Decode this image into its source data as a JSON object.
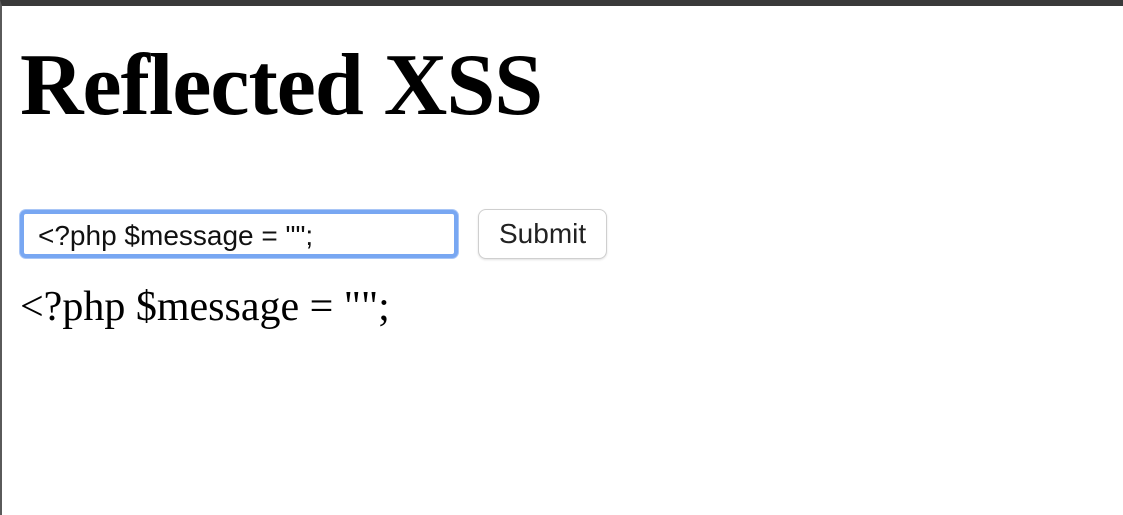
{
  "page": {
    "heading": "Reflected XSS"
  },
  "form": {
    "input_value": "<?php $message = \"\";",
    "submit_label": "Submit"
  },
  "output": {
    "reflected_text": "<?php $message = \"\";"
  },
  "colors": {
    "focus_ring": "#78a7f2",
    "text": "#000000",
    "background": "#ffffff"
  }
}
